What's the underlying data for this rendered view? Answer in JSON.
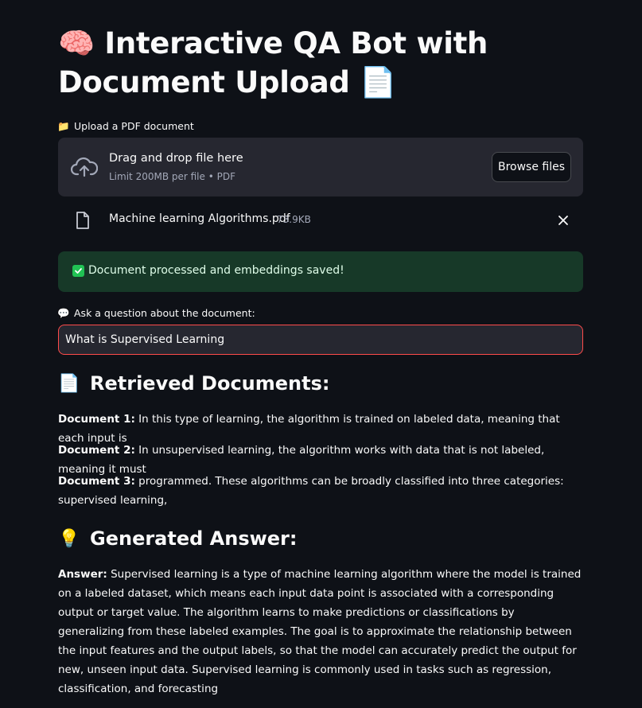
{
  "header": {
    "title_emoji": "🧠",
    "title_text": "Interactive QA Bot with Document Upload",
    "title_trailing_emoji": "📄"
  },
  "upload": {
    "label_icon": "📁",
    "label": "Upload a PDF document",
    "drop_title": "Drag and drop file here",
    "drop_limit": "Limit 200MB per file • PDF",
    "browse_label": "Browse files",
    "file_name": "Machine learning Algorithms.pdf",
    "file_size": "73.9KB"
  },
  "status": {
    "success_message": "Document processed and embeddings saved!"
  },
  "question": {
    "label_icon": "💬",
    "label": "Ask a question about the document:",
    "value": "What is Supervised Learning"
  },
  "retrieved": {
    "heading_icon": "📄",
    "heading": "Retrieved Documents:",
    "docs": [
      {
        "label": "Document 1:",
        "text": "In this type of learning, the algorithm is trained on labeled data, meaning that each input is"
      },
      {
        "label": "Document 2:",
        "text": "In unsupervised learning, the algorithm works with data that is not labeled, meaning it must"
      },
      {
        "label": "Document 3:",
        "text": "programmed. These algorithms can be broadly classified into three categories: supervised learning,"
      }
    ]
  },
  "answer": {
    "heading_icon": "💡",
    "heading": "Generated Answer:",
    "label": "Answer:",
    "text": "Supervised learning is a type of machine learning algorithm where the model is trained on a labeled dataset, which means each input data point is associated with a corresponding output or target value. The algorithm learns to make predictions or classifications by generalizing from these labeled examples. The goal is to approximate the relationship between the input features and the output labels, so that the model can accurately predict the output for new, unseen input data. Supervised learning is commonly used in tasks such as regression, classification, and forecasting"
  },
  "colors": {
    "background": "#0e1117",
    "panel": "#262730",
    "accent": "#ff4b4b",
    "success_bg": "#173928",
    "success_check": "#21c354"
  }
}
